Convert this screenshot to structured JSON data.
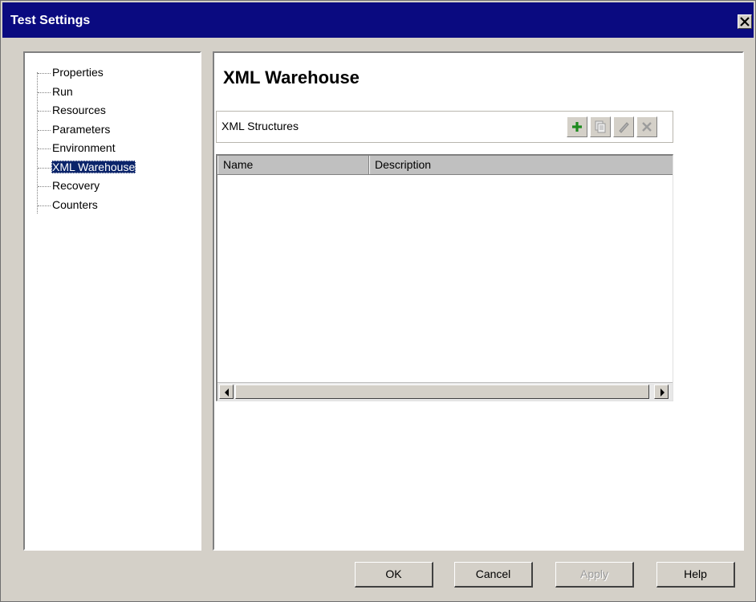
{
  "window": {
    "title": "Test Settings"
  },
  "tree": {
    "items": [
      {
        "label": "Properties",
        "selected": false
      },
      {
        "label": "Run",
        "selected": false
      },
      {
        "label": "Resources",
        "selected": false
      },
      {
        "label": "Parameters",
        "selected": false
      },
      {
        "label": "Environment",
        "selected": false
      },
      {
        "label": "XML Warehouse",
        "selected": true
      },
      {
        "label": "Recovery",
        "selected": false
      },
      {
        "label": "Counters",
        "selected": false
      }
    ]
  },
  "content": {
    "title": "XML Warehouse",
    "structures_label": "XML Structures",
    "toolbar_icons": [
      "add-icon",
      "copy-icon",
      "edit-icon",
      "delete-icon"
    ],
    "grid": {
      "columns": [
        "Name",
        "Description"
      ],
      "rows": []
    }
  },
  "buttons": {
    "ok": "OK",
    "cancel": "Cancel",
    "apply": "Apply",
    "apply_disabled": true,
    "help": "Help"
  },
  "colors": {
    "title_bar": "#0a0a80",
    "selection": "#0a246a",
    "dialog_face": "#d4d0c8",
    "add_icon": "#1e8a1e"
  }
}
